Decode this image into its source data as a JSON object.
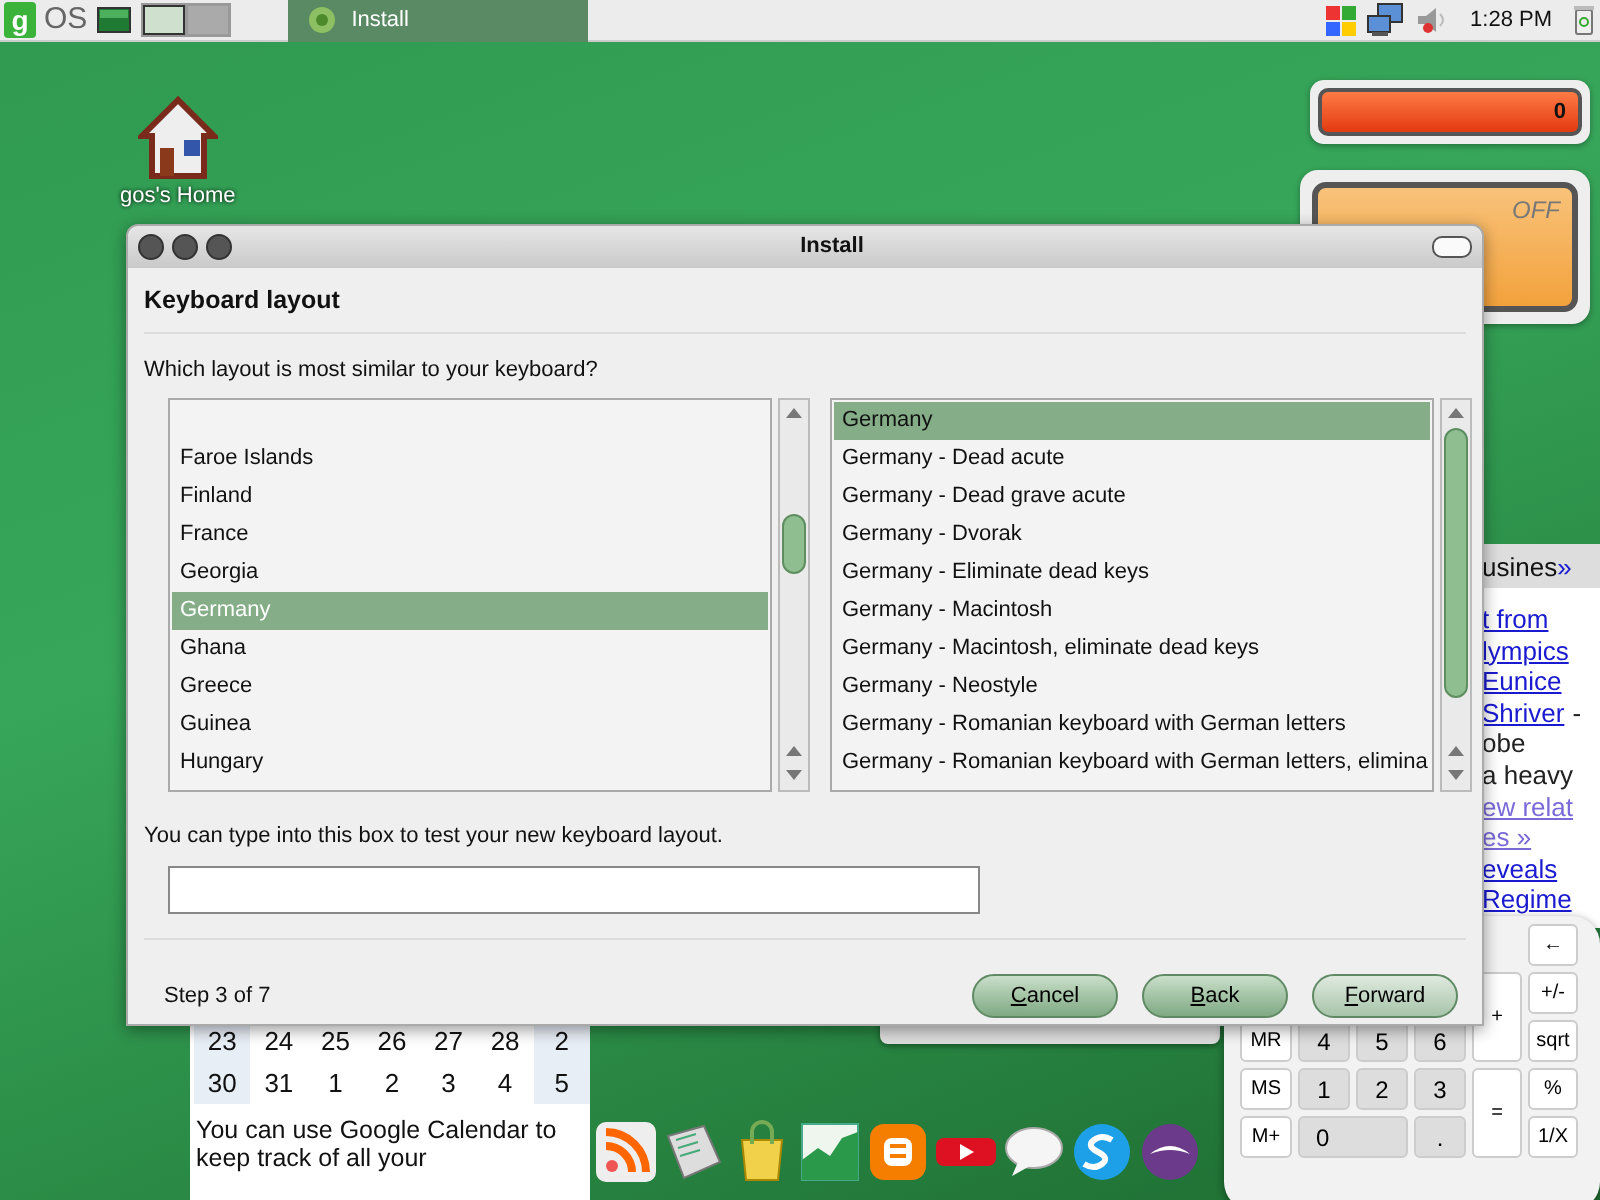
{
  "panel": {
    "logo": {
      "mark": "g",
      "text": "OS"
    },
    "tasks": [
      {
        "label": "Install",
        "selected": true
      }
    ],
    "clock": "1:28 PM"
  },
  "desktop_icons": [
    {
      "label": "gos's Home"
    }
  ],
  "meter_widget": {
    "reading": "0"
  },
  "switch_widget": {
    "state": "OFF"
  },
  "news_widget": {
    "tab": "usines",
    "more": "»",
    "lines": [
      [
        {
          "text": "t from",
          "kind": "link"
        }
      ],
      [
        {
          "text": "lympics",
          "kind": "link"
        }
      ],
      [
        {
          "text": "Eunice",
          "kind": "link"
        }
      ],
      [
        {
          "text": "Shriver",
          "kind": "link"
        },
        {
          "text": "-",
          "kind": "text"
        }
      ],
      [
        {
          "text": "obe",
          "kind": "text"
        }
      ],
      [
        {
          "text": "a heavy",
          "kind": "text"
        }
      ],
      [
        {
          "text": "ew relat",
          "kind": "visited"
        }
      ],
      [
        {
          "text": "es »",
          "kind": "visited"
        }
      ],
      [
        {
          "text": "eveals",
          "kind": "link"
        }
      ],
      [
        {
          "text": "Regime",
          "kind": "link"
        }
      ]
    ]
  },
  "dialog": {
    "title": "Install",
    "heading": "Keyboard layout",
    "question": "Which layout is most similar to your keyboard?",
    "layouts": [
      {
        "label": "Faroe Islands",
        "selected": false
      },
      {
        "label": "Finland",
        "selected": false
      },
      {
        "label": "France",
        "selected": false
      },
      {
        "label": "Georgia",
        "selected": false
      },
      {
        "label": "Germany",
        "selected": true
      },
      {
        "label": "Ghana",
        "selected": false
      },
      {
        "label": "Greece",
        "selected": false
      },
      {
        "label": "Guinea",
        "selected": false
      },
      {
        "label": "Hungary",
        "selected": false
      }
    ],
    "variants": [
      {
        "label": "Germany",
        "selected": true
      },
      {
        "label": "Germany - Dead acute",
        "selected": false
      },
      {
        "label": "Germany - Dead grave acute",
        "selected": false
      },
      {
        "label": "Germany - Dvorak",
        "selected": false
      },
      {
        "label": "Germany - Eliminate dead keys",
        "selected": false
      },
      {
        "label": "Germany - Macintosh",
        "selected": false
      },
      {
        "label": "Germany - Macintosh, eliminate dead keys",
        "selected": false
      },
      {
        "label": "Germany - Neostyle",
        "selected": false
      },
      {
        "label": "Germany - Romanian keyboard with German letters",
        "selected": false
      },
      {
        "label": "Germany - Romanian keyboard with German letters, elimina",
        "selected": false
      }
    ],
    "test_label": "You can type into this box to test your new keyboard layout.",
    "step": "Step 3 of 7",
    "buttons": [
      {
        "mnemonic": "C",
        "rest": "ancel"
      },
      {
        "mnemonic": "B",
        "rest": "ack"
      },
      {
        "mnemonic": "F",
        "rest": "orward"
      }
    ]
  },
  "calendar_widget": {
    "weeks": [
      [
        "23",
        "24",
        "25",
        "26",
        "27",
        "28",
        "2"
      ],
      [
        "30",
        "31",
        "1",
        "2",
        "3",
        "4",
        "5"
      ]
    ],
    "note": "You can use Google Calendar to keep track of all your"
  },
  "calculator": {
    "keys": [
      "←",
      "+/-",
      "+",
      "MR",
      "4",
      "5",
      "6",
      "sqrt",
      "MS",
      "1",
      "2",
      "3",
      "=",
      "%",
      "M+",
      "0",
      ".",
      "1/X"
    ]
  }
}
